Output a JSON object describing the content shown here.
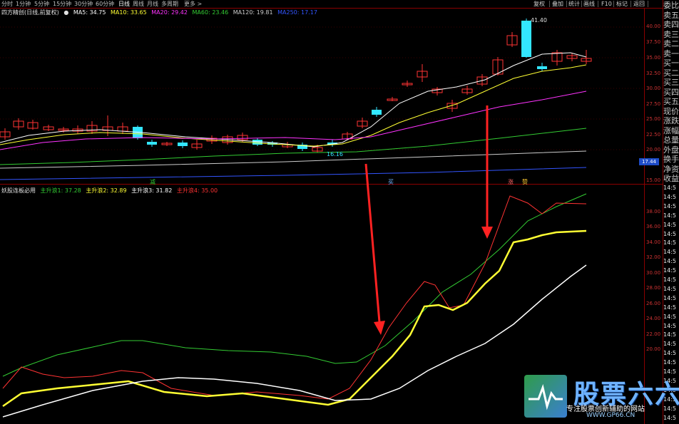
{
  "toolbar": {
    "left_items": [
      "分时",
      "1分钟",
      "5分钟",
      "15分钟",
      "30分钟",
      "60分钟",
      "日线",
      "周线",
      "月线",
      "多周期",
      "更多 >"
    ],
    "right_items": [
      "复权",
      "叠加",
      "统计",
      "画线",
      "F10",
      "标记",
      "返回"
    ],
    "active": "日线"
  },
  "main_legend": {
    "title": "四方精创(日线,前复权)",
    "ma5": "MA5: 34.75",
    "ma10": "MA10: 33.65",
    "ma20": "MA20: 29.42",
    "ma60": "MA60: 23.46",
    "ma120": "MA120: 19.81",
    "ma250": "MA250: 17.17"
  },
  "main_axis": [
    "40.00",
    "37.50",
    "35.00",
    "32.50",
    "30.00",
    "27.50",
    "25.00",
    "22.50",
    "20.00",
    "17.44",
    "15.00"
  ],
  "price_marks": {
    "high": "41.40",
    "low": "16.16"
  },
  "indicator_legend": {
    "title": "妖股连板必用",
    "w1": "主升浪1: 37.28",
    "w2": "主升浪2: 32.89",
    "w3": "主升浪3: 31.82",
    "w4": "主升浪4: 35.00"
  },
  "indicator_axis": [
    "38.00",
    "36.00",
    "34.00",
    "32.00",
    "30.00",
    "28.00",
    "26.00",
    "24.00",
    "22.00",
    "20.00"
  ],
  "event_badges": [
    "减",
    "买",
    "涨",
    "赞"
  ],
  "side_panel": [
    "委比",
    "卖五",
    "卖四",
    "卖三",
    "卖二",
    "卖一",
    "买一",
    "买二",
    "买三",
    "买四",
    "买五",
    "现价",
    "涨跌",
    "涨幅",
    "总量",
    "外盘",
    "换手",
    "净资",
    "收益"
  ],
  "time_column": [
    "14:5",
    "14:5",
    "14:5",
    "14:5",
    "14:5",
    "14:5",
    "14:5",
    "14:5",
    "14:5",
    "14:5",
    "14:5",
    "14:5",
    "14:5",
    "14:5",
    "14:5",
    "14:5",
    "14:5",
    "14:5",
    "14:5",
    "14:5",
    "14:5",
    "14:5",
    "14:5",
    "14:5",
    "14:5",
    "14:5"
  ],
  "watermark": {
    "brand": "股票六六",
    "slogan": "专注股票创新辅助的网站",
    "url": "WWW.GP66.CN"
  },
  "colors": {
    "up": "#ff3333",
    "down": "#33e6ff",
    "ma5": "#ffffff",
    "ma10": "#ffff33",
    "ma20": "#ff33ff",
    "ma60": "#33cc33",
    "ma120": "#cccccc",
    "ma250": "#3355ff",
    "arrow": "#ff2222"
  }
}
